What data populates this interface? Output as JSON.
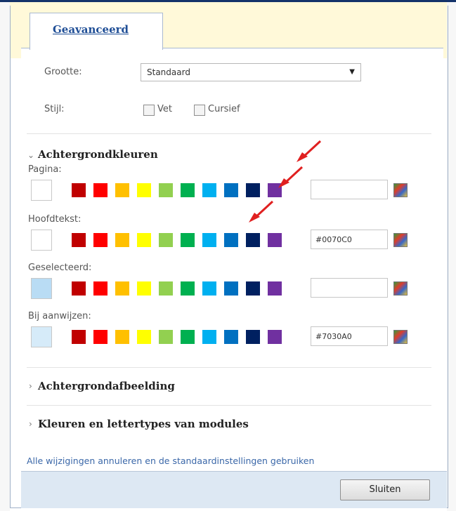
{
  "tab": {
    "label": "Geavanceerd"
  },
  "fields": {
    "grootte_label": "Grootte:",
    "grootte_value": "Standaard",
    "stijl_label": "Stijl:",
    "vet_label": "Vet",
    "vet_checked": false,
    "cursief_label": "Cursief",
    "cursief_checked": false
  },
  "sections": {
    "background_colors": "Achtergrondkleuren",
    "background_image": "Achtergrondafbeelding",
    "module_colors": "Kleuren en lettertypes van modules"
  },
  "palette": [
    "#c00000",
    "#ff0000",
    "#ffc000",
    "#ffff00",
    "#92d050",
    "#00b050",
    "#00b0f0",
    "#0070c0",
    "#002060",
    "#7030a0"
  ],
  "color_rows": [
    {
      "label": "Pagina:",
      "preview_color": "#ffffff",
      "hex": ""
    },
    {
      "label": "Hoofdtekst:",
      "preview_color": "#ffffff",
      "hex": "#0070C0"
    },
    {
      "label": "Geselecteerd:",
      "preview_color": "#b9dcf4",
      "hex": ""
    },
    {
      "label": "Bij aanwijzen:",
      "preview_color": "#d6ebf9",
      "hex": "#7030A0"
    }
  ],
  "reset_link": "Alle wijzigingen annuleren en de standaardinstellingen gebruiken",
  "close_button": "Sluiten",
  "accent": {
    "arrow": "#e02020",
    "tab_text": "#1f4e96",
    "link": "#3a67a8",
    "footer": "#dde8f3"
  },
  "icons": {
    "collapse": "chevron-down-icon",
    "expand": "chevron-right-icon",
    "picker": "color-picker-icon"
  }
}
